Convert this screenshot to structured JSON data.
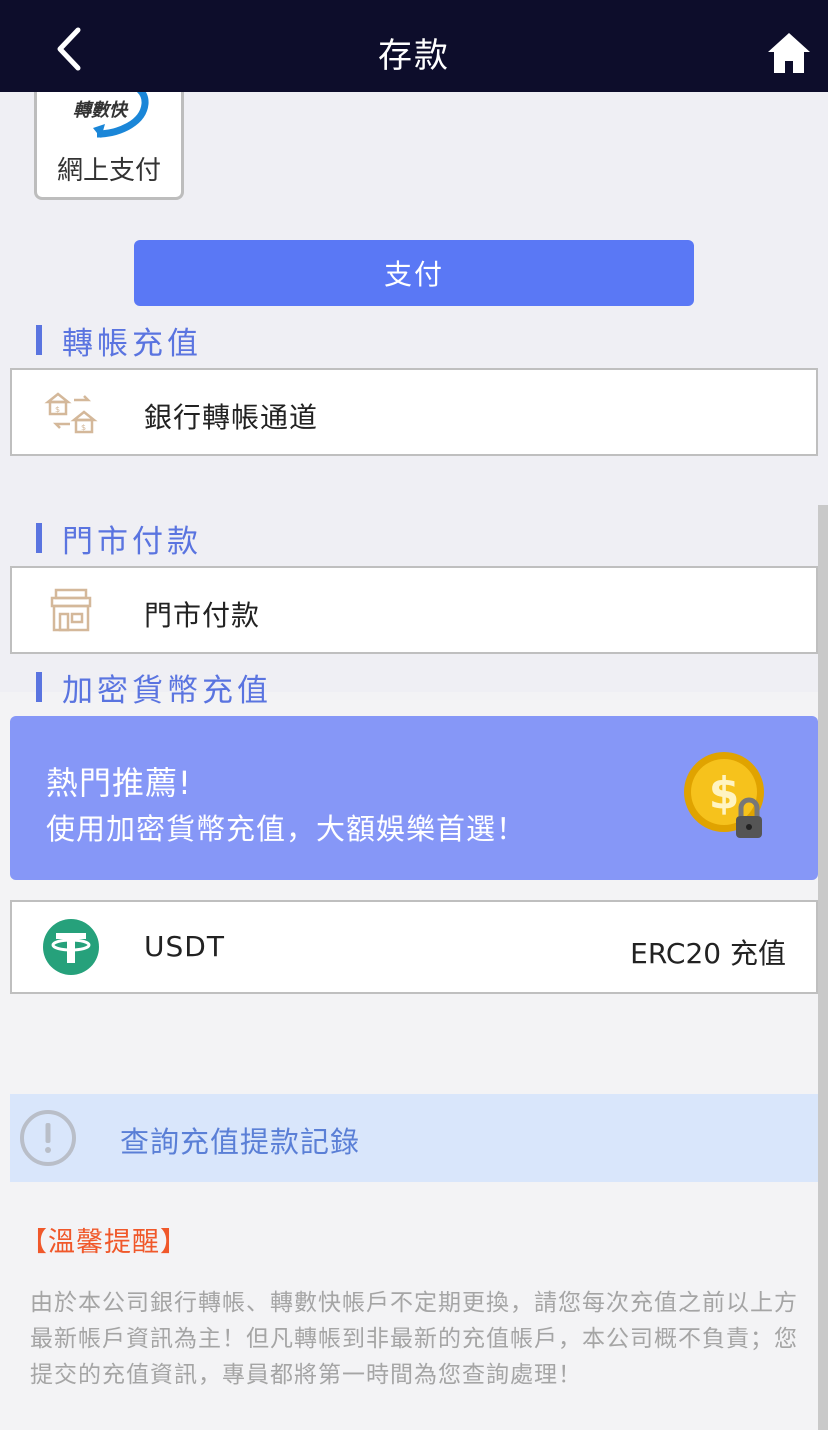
{
  "header": {
    "title": "存款"
  },
  "payment_method": {
    "logo_text": "轉數快",
    "label": "網上支付"
  },
  "pay_button": {
    "label": "支付"
  },
  "sections": {
    "transfer": {
      "heading": "轉帳充值",
      "row_label": "銀行轉帳通道"
    },
    "store": {
      "heading": "門市付款",
      "row_label": "門市付款"
    },
    "crypto": {
      "heading": "加密貨幣充值",
      "promo_title": "熱門推薦!",
      "promo_sub": "使用加密貨幣充值，大額娛樂首選！",
      "usdt_label": "USDT",
      "usdt_right": "ERC20 充值"
    }
  },
  "query": {
    "label": "查詢充值提款記錄"
  },
  "notice": {
    "title": "【溫馨提醒】",
    "body": "由於本公司銀行轉帳、轉數快帳戶不定期更換，請您每次充值之前以上方最新帳戶資訊為主！但凡轉帳到非最新的充值帳戶，本公司概不負責；您提交的充值資訊，專員都將第一時間為您查詢處理！"
  },
  "colors": {
    "header_bg": "#0d0d2b",
    "accent": "#5a78f5",
    "promo_bg": "#8697f7",
    "notice_title": "#f0582a",
    "usdt_green": "#26a17b"
  },
  "icons": {
    "back": "chevron-left-icon",
    "home": "home-icon",
    "bank_transfer": "bank-transfer-icon",
    "store": "store-icon",
    "coin": "coin-lock-icon",
    "usdt": "tether-icon",
    "info": "exclamation-circle-icon"
  }
}
